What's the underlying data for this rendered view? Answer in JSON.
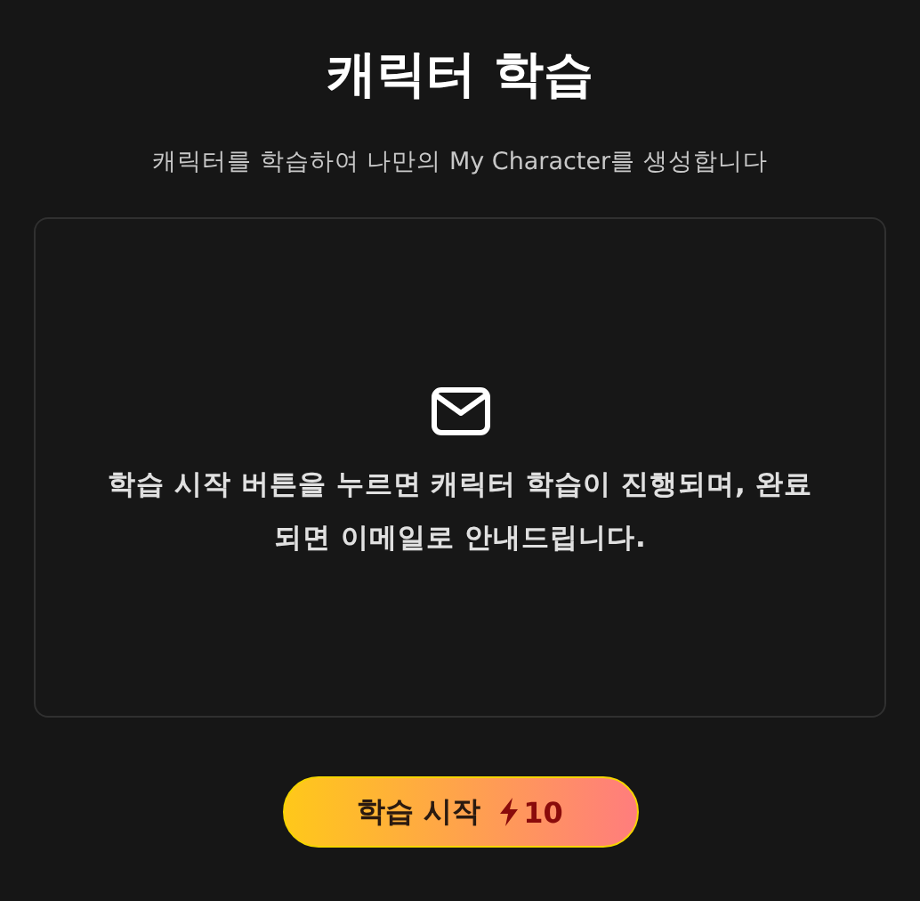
{
  "title": "캐릭터 학습",
  "subtitle": "캐릭터를 학습하여 나만의 My Character를 생성합니다",
  "notice": {
    "message": "학습 시작 버튼을 누르면 캐릭터 학습이 진행되며, 완료되면 이메일로 안내드립니다."
  },
  "start_button": {
    "label": "학습 시작",
    "cost": "10"
  }
}
